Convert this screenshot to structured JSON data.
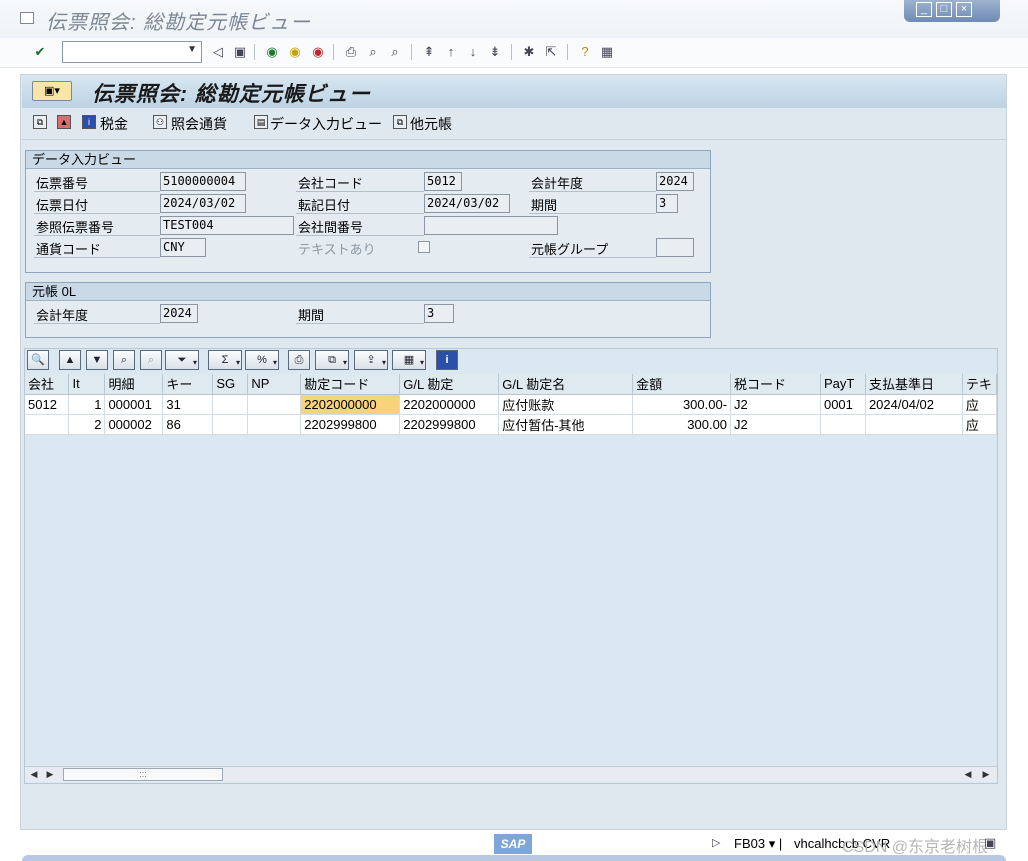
{
  "window": {
    "title": "伝票照会: 総勘定元帳ビュー"
  },
  "toolbar": {
    "command_value": ""
  },
  "header": {
    "title": "伝票照会: 総勘定元帳ビュー"
  },
  "app_toolbar": {
    "tax": "税金",
    "display_currency": "照会通貨",
    "entry_view": "データ入力ビュー",
    "other_ledger": "他元帳"
  },
  "entry_view": {
    "title": "データ入力ビュー",
    "doc_number_label": "伝票番号",
    "doc_number": "5100000004",
    "company_code_label": "会社コード",
    "company_code": "5012",
    "fiscal_year_label": "会計年度",
    "fiscal_year": "2024",
    "doc_date_label": "伝票日付",
    "doc_date": "2024/03/02",
    "posting_date_label": "転記日付",
    "posting_date": "2024/03/02",
    "period_label": "期間",
    "period": "3",
    "reference_label": "参照伝票番号",
    "reference": "TEST004",
    "intercompany_label": "会社間番号",
    "intercompany": "",
    "currency_label": "通貨コード",
    "currency": "CNY",
    "texts_label": "テキストあり",
    "ledger_group_label": "元帳グループ",
    "ledger_group": ""
  },
  "ledger": {
    "title": "元帳 0L",
    "fiscal_year_label": "会計年度",
    "fiscal_year": "2024",
    "period_label": "期間",
    "period": "3"
  },
  "grid": {
    "columns": [
      "会社",
      "It",
      "明細",
      "キー",
      "SG",
      "NP",
      "勘定コード",
      "G/L 勘定",
      "G/L 勘定名",
      "金額",
      "税コード",
      "PayT",
      "支払基準日",
      "テキ"
    ],
    "rows": [
      [
        "5012",
        "1",
        "000001",
        "31",
        "",
        "",
        "2202000000",
        "2202000000",
        "应付账款",
        "300.00-",
        "J2",
        "0001",
        "2024/04/02",
        "应"
      ],
      [
        "",
        "2",
        "000002",
        "86",
        "",
        "",
        "2202999800",
        "2202999800",
        "应付暂估-其他",
        "300.00",
        "J2",
        "",
        "",
        "应"
      ]
    ]
  },
  "status": {
    "transaction": "FB03",
    "host": "vhcalhcbcb",
    "system": "CVR"
  },
  "watermark": "CSDN @东京老树根",
  "logo": "SAP"
}
